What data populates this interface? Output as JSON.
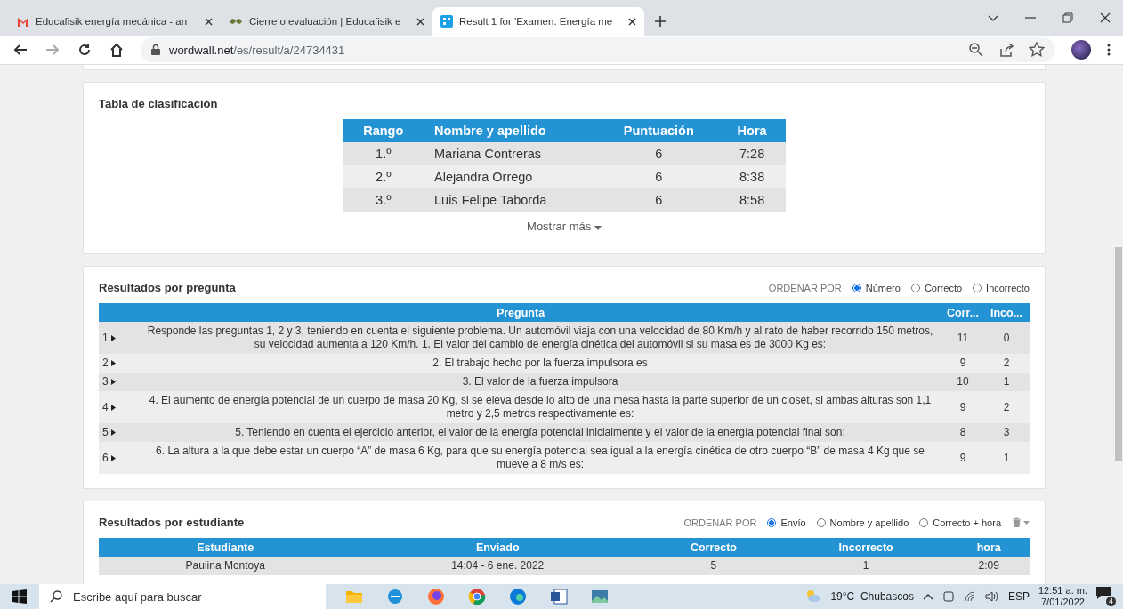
{
  "browser": {
    "tabs": [
      {
        "title": "Educafisik energía mecánica - an",
        "selected": false
      },
      {
        "title": "Cierre o evaluación | Educafisik e",
        "selected": false
      },
      {
        "title": "Result 1 for 'Examen. Energía me",
        "selected": true
      }
    ],
    "url_host": "wordwall.net",
    "url_path": "/es/result/a/24734431"
  },
  "leaderboard": {
    "title": "Tabla de clasificación",
    "columns": [
      "Rango",
      "Nombre y apellido",
      "Puntuación",
      "Hora"
    ],
    "rows": [
      [
        "1.º",
        "Mariana Contreras",
        "6",
        "7:28"
      ],
      [
        "2.º",
        "Alejandra Orrego",
        "6",
        "8:38"
      ],
      [
        "3.º",
        "Luis Felipe Taborda",
        "6",
        "8:58"
      ]
    ],
    "more": "Mostrar más"
  },
  "by_question": {
    "title": "Resultados por pregunta",
    "sort_label": "ORDENAR POR",
    "sort_options": [
      {
        "label": "Número",
        "selected": true
      },
      {
        "label": "Correcto",
        "selected": false
      },
      {
        "label": "Incorrecto",
        "selected": false
      }
    ],
    "columns": [
      "Pregunta",
      "Corr...",
      "Inco..."
    ],
    "rows": [
      {
        "number": "1",
        "question": "Responde las preguntas 1, 2 y 3, teniendo en cuenta el siguiente problema. Un automóvil viaja con una velocidad de 80 Km/h y al rato de haber recorrido 150 metros, su velocidad aumenta a 120 Km/h. 1. El valor del cambio de energía cinética del automóvil si su masa es de 3000 Kg es:",
        "correct": "11",
        "incorrect": "0"
      },
      {
        "number": "2",
        "question": "2. El trabajo hecho por la fuerza impulsora es",
        "correct": "9",
        "incorrect": "2"
      },
      {
        "number": "3",
        "question": "3. El valor de la fuerza impulsora",
        "correct": "10",
        "incorrect": "1"
      },
      {
        "number": "4",
        "question": "4. El aumento de energía potencial de un cuerpo de masa 20 Kg, si se eleva desde lo alto de una mesa hasta la parte superior de un closet, si ambas alturas son 1,1 metro y 2,5 metros respectivamente es:",
        "correct": "9",
        "incorrect": "2"
      },
      {
        "number": "5",
        "question": "5. Teniendo en cuenta el ejercicio anterior, el valor de la energía potencial inicialmente y el valor de la energía potencial final son:",
        "correct": "8",
        "incorrect": "3"
      },
      {
        "number": "6",
        "question": "6. La altura a la que debe estar un cuerpo “A” de masa 6 Kg, para que su energía potencial sea igual a la energía cinética de otro cuerpo “B” de masa 4 Kg que se mueve a 8 m/s es:",
        "correct": "9",
        "incorrect": "1"
      }
    ]
  },
  "by_student": {
    "title": "Resultados por estudiante",
    "sort_label": "ORDENAR POR",
    "sort_options": [
      {
        "label": "Envío",
        "selected": true
      },
      {
        "label": "Nombre y apellido",
        "selected": false
      },
      {
        "label": "Correcto + hora",
        "selected": false
      }
    ],
    "columns": [
      "Estudiante",
      "Enviado",
      "Correcto",
      "Incorrecto",
      "hora"
    ],
    "rows": [
      [
        "Paulina Montoya",
        "14:04 - 6 ene. 2022",
        "5",
        "1",
        "2:09"
      ]
    ]
  },
  "taskbar": {
    "search_placeholder": "Escribe aquí para buscar",
    "weather": "19°C  Chubascos",
    "language": "ESP",
    "time": "12:51 a. m.",
    "date": "7/01/2022",
    "notifications": "4"
  }
}
